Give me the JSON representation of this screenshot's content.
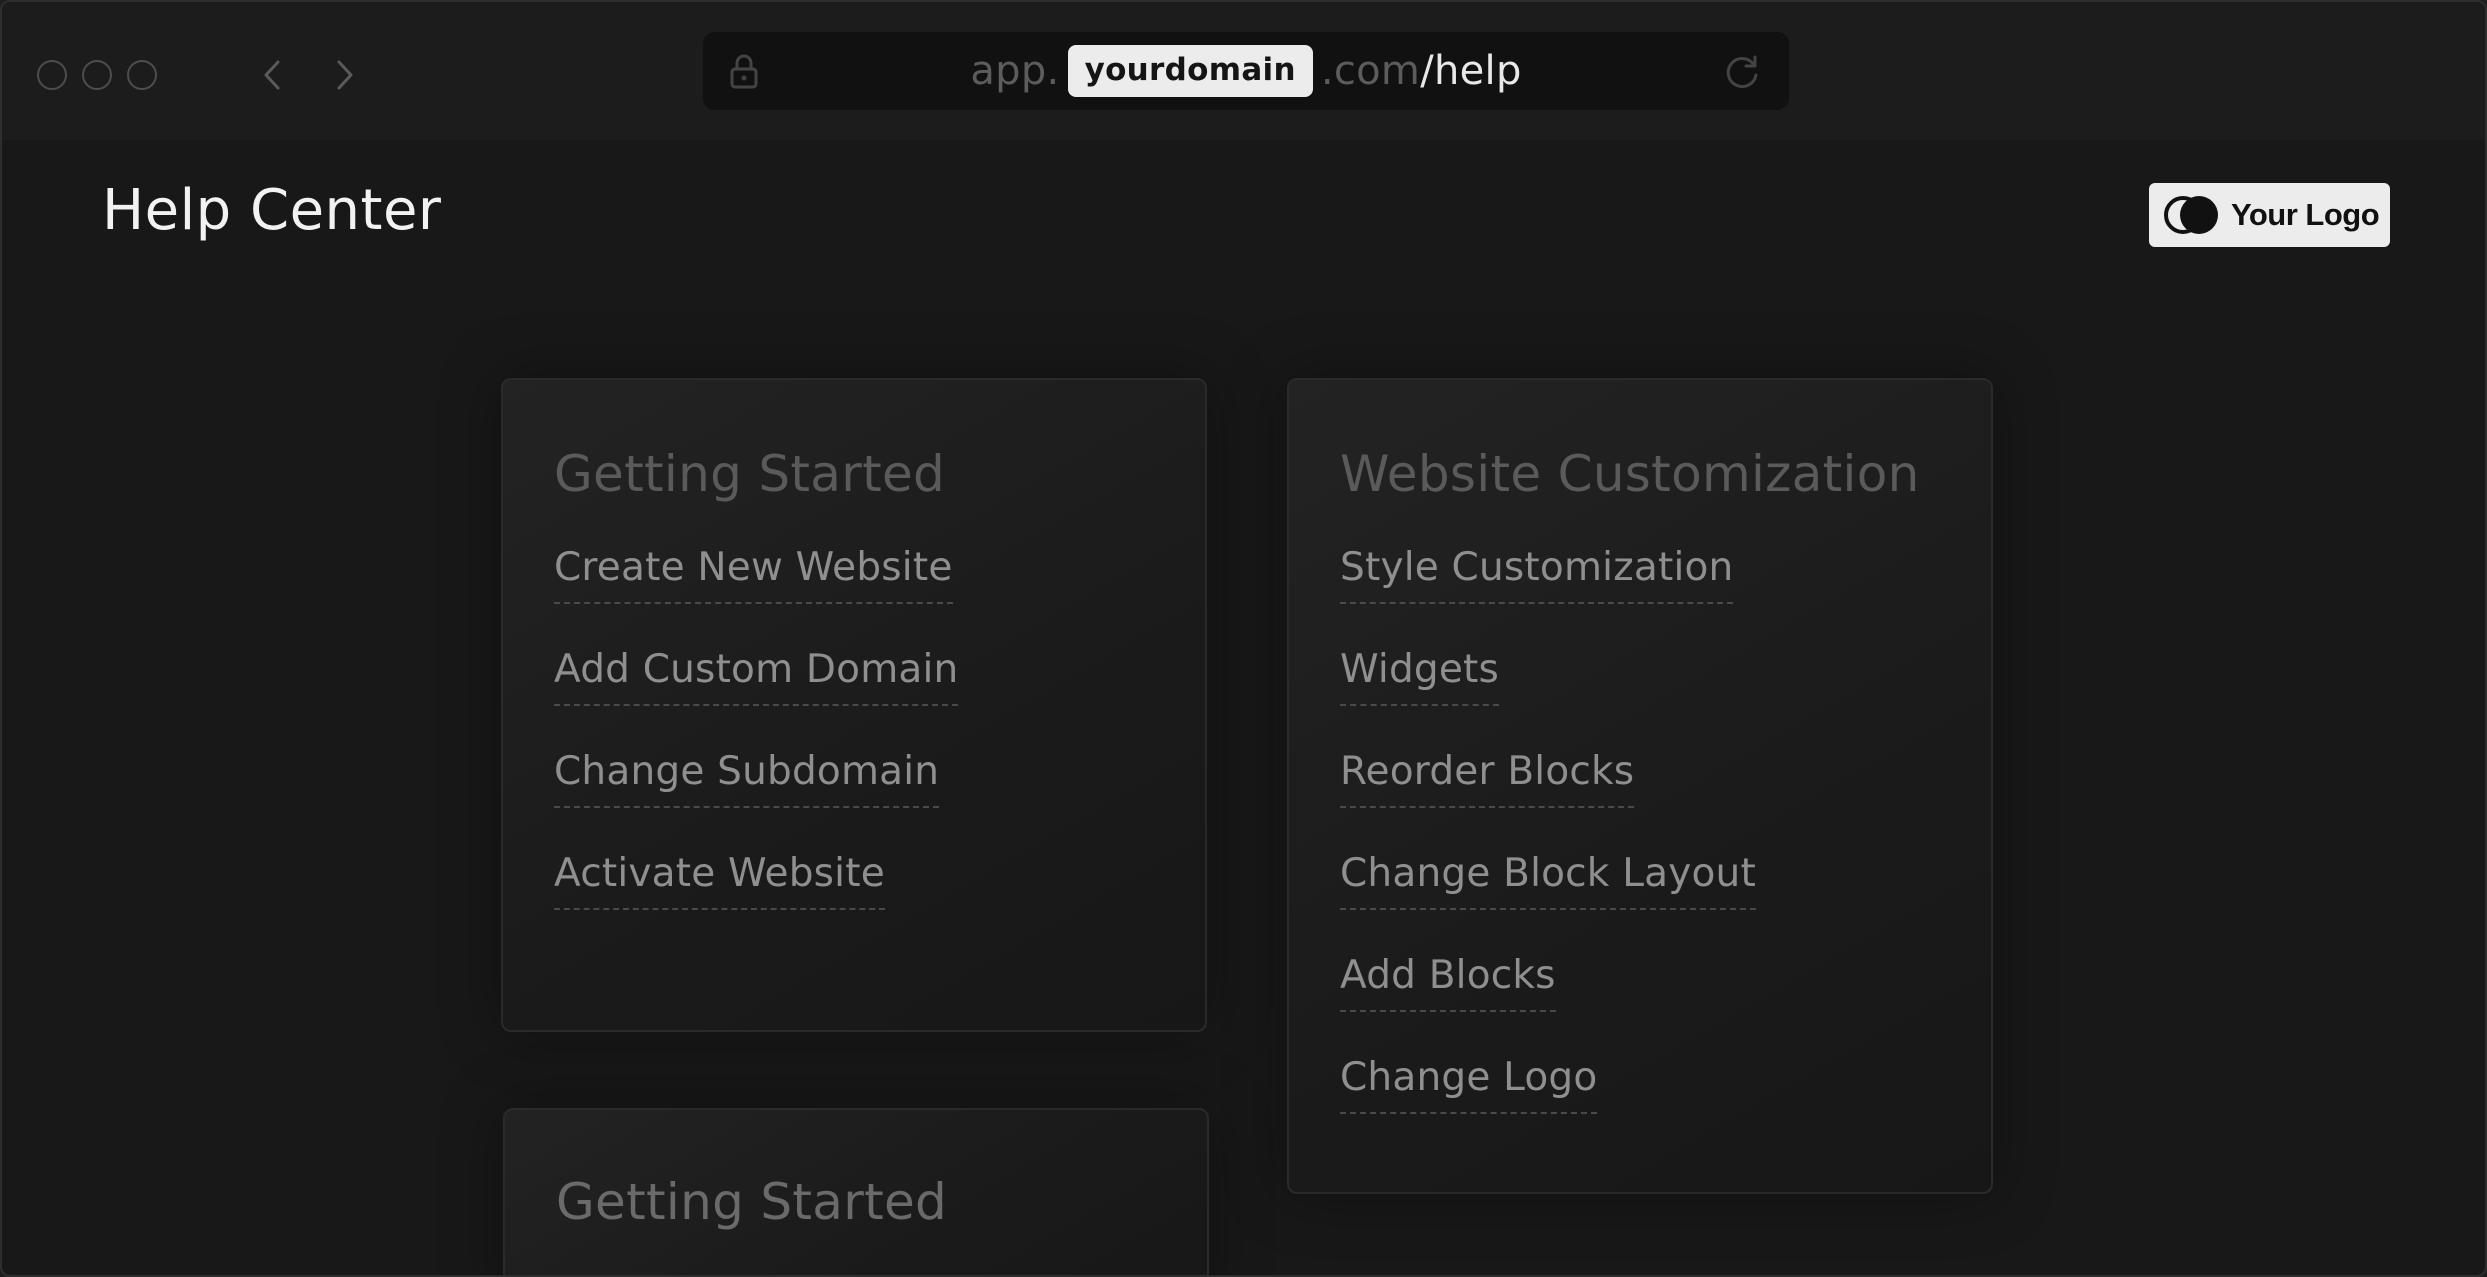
{
  "browser": {
    "url_prefix": "app.",
    "url_domain": "yourdomain",
    "url_tld": ".com",
    "url_path": "/help"
  },
  "header": {
    "title": "Help Center",
    "logo_text": "Your Logo"
  },
  "cards": [
    {
      "title": "Getting Started",
      "links": [
        "Create New Website",
        "Add Custom Domain",
        "Change Subdomain",
        "Activate Website"
      ]
    },
    {
      "title": "Website Customization",
      "links": [
        "Style Customization",
        "Widgets",
        "Reorder Blocks",
        "Change Block Layout",
        "Add Blocks",
        "Change Logo"
      ]
    },
    {
      "title": "Getting Started",
      "links": []
    }
  ],
  "colors": {
    "background": "#181818",
    "card_title": "#5a5a5a",
    "link": "#8f8f8f",
    "url_highlight_bg": "#ececec"
  }
}
